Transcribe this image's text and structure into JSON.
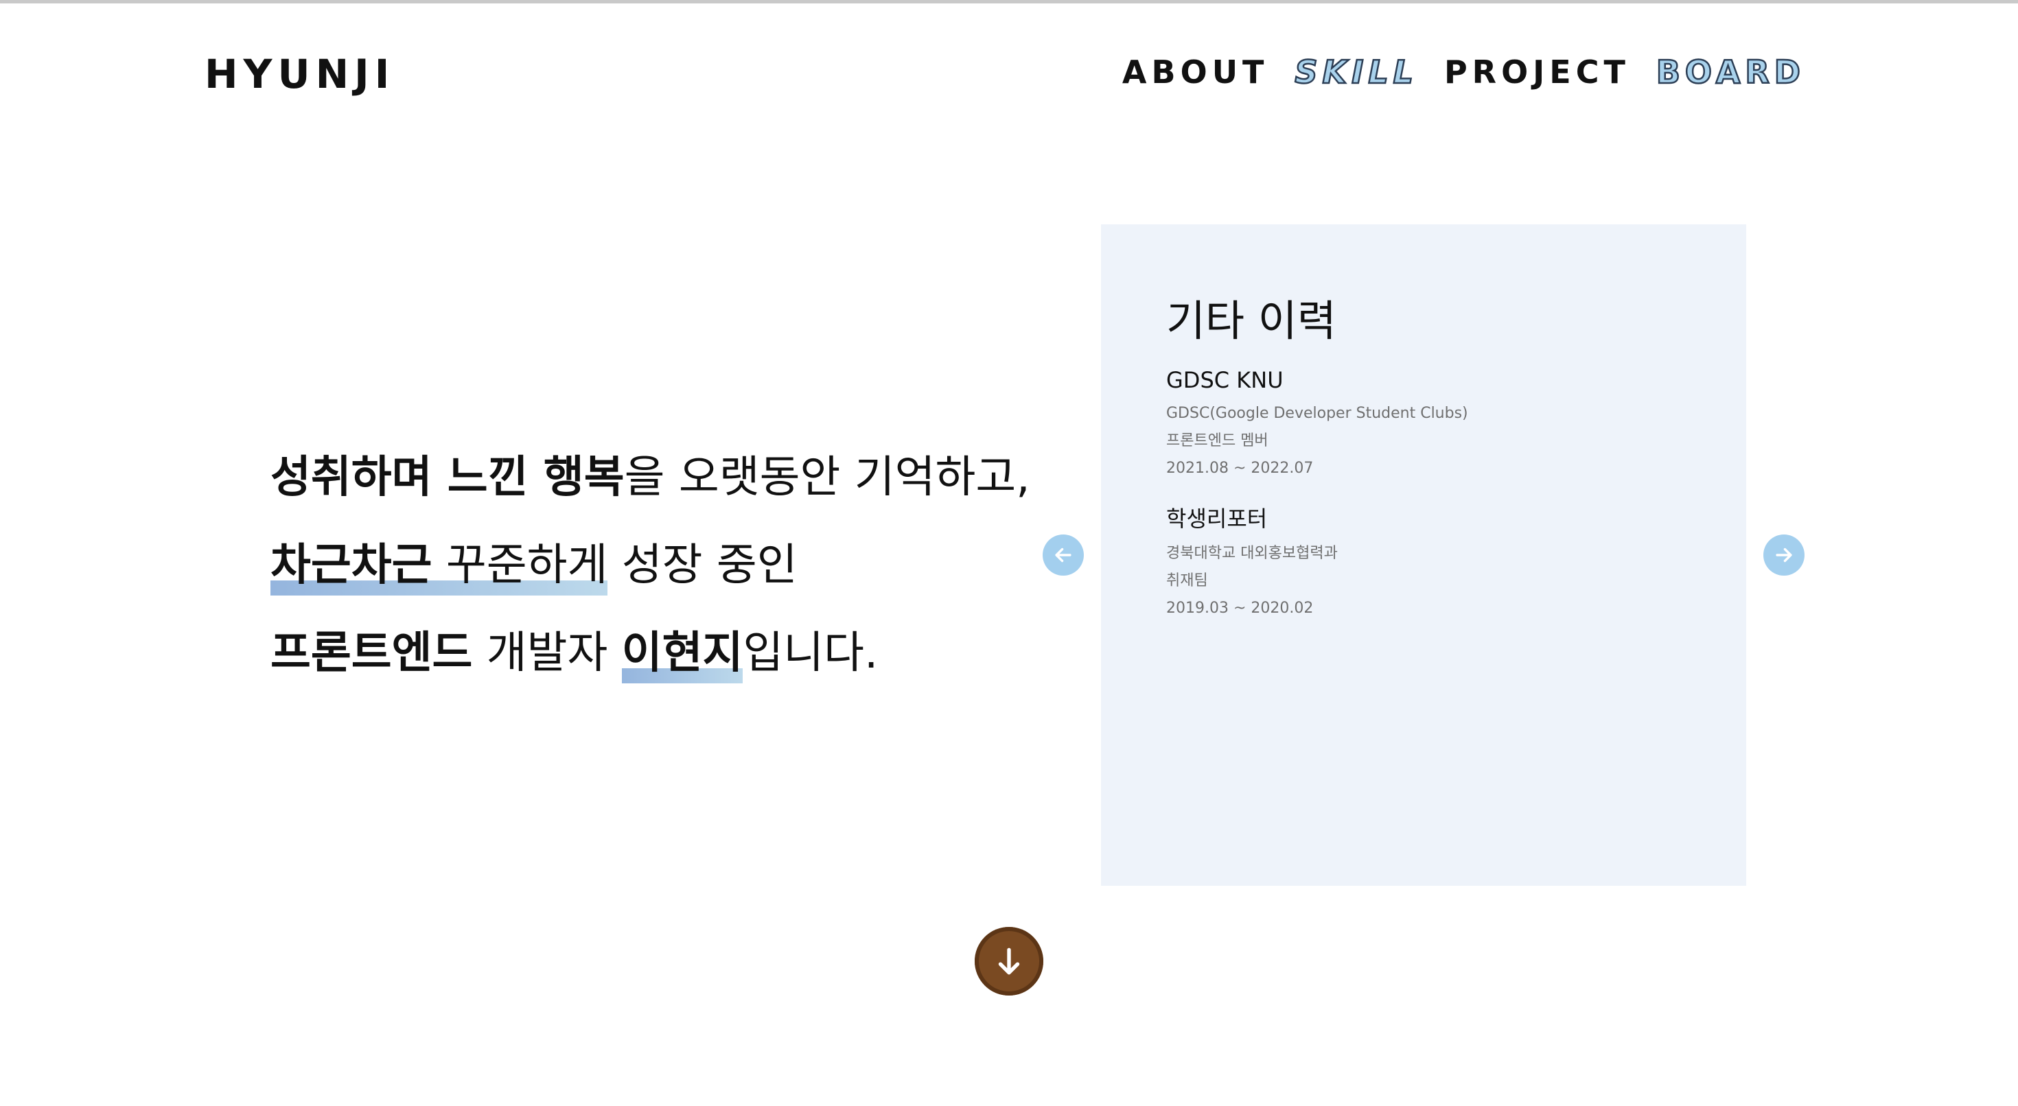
{
  "header": {
    "logo": "HYUNJI",
    "nav": [
      {
        "label": "ABOUT"
      },
      {
        "label": "SKILL"
      },
      {
        "label": "PROJECT"
      },
      {
        "label": "BOARD"
      }
    ]
  },
  "hero": {
    "line1": {
      "bold": "성취하며 느낀 행복",
      "rest": "을 오랫동안 기억하고,"
    },
    "line2": {
      "bold": "차근차근",
      "rest": " 꾸준하게",
      "tail": " 성장 중인"
    },
    "line3": {
      "bold1": "프론트엔드",
      "mid": " 개발자 ",
      "bold2": "이현지",
      "tail": "입니다."
    }
  },
  "card": {
    "title": "기타 이력",
    "entries": [
      {
        "title": "GDSC KNU",
        "lines": [
          "GDSC(Google Developer Student Clubs)",
          "프론트엔드 멤버",
          "2021.08 ~ 2022.07"
        ]
      },
      {
        "title": "학생리포터",
        "lines": [
          "경북대학교 대외홍보협력과",
          "취재팀",
          "2019.03 ~ 2020.02"
        ]
      }
    ]
  },
  "icons": {
    "prev": "arrow-left-icon",
    "next": "arrow-right-icon",
    "scroll": "arrow-down-icon"
  },
  "colors": {
    "accent_blue": "#a3cfee",
    "card_bg": "#eef3fa",
    "highlight": "#8fb1dc",
    "scroll_button": "#7a4a22"
  }
}
